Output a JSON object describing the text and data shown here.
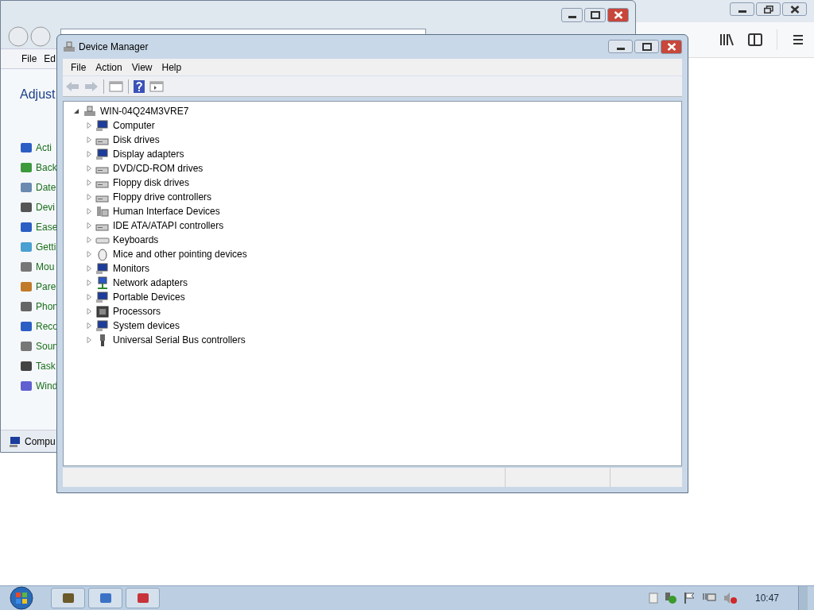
{
  "control_panel": {
    "menu": [
      "File",
      "Ed"
    ],
    "heading": "Adjust",
    "items": [
      "Acti",
      "Back",
      "Date",
      "Devi",
      "Ease",
      "Getti",
      "Mou",
      "Pare",
      "Phon",
      "Reco",
      "Soun",
      "Task",
      "Wind"
    ],
    "status": "Compu"
  },
  "device_manager": {
    "title": "Device Manager",
    "menu": [
      "File",
      "Action",
      "View",
      "Help"
    ],
    "tree": {
      "label": "WIN-04Q24M3VRE7",
      "expanded": true,
      "children": [
        {
          "label": "Computer",
          "expanded": false
        },
        {
          "label": "Disk drives",
          "expanded": false
        },
        {
          "label": "Display adapters",
          "expanded": false
        },
        {
          "label": "DVD/CD-ROM drives",
          "expanded": false
        },
        {
          "label": "Floppy disk drives",
          "expanded": false
        },
        {
          "label": "Floppy drive controllers",
          "expanded": false
        },
        {
          "label": "Human Interface Devices",
          "expanded": false
        },
        {
          "label": "IDE ATA/ATAPI controllers",
          "expanded": false
        },
        {
          "label": "Keyboards",
          "expanded": false
        },
        {
          "label": "Mice and other pointing devices",
          "expanded": false
        },
        {
          "label": "Monitors",
          "expanded": false
        },
        {
          "label": "Network adapters",
          "expanded": false
        },
        {
          "label": "Portable Devices",
          "expanded": false
        },
        {
          "label": "Processors",
          "expanded": false
        },
        {
          "label": "System devices",
          "expanded": false
        },
        {
          "label": "Universal Serial Bus controllers",
          "expanded": false
        }
      ]
    }
  },
  "taskbar": {
    "clock": "10:47"
  }
}
